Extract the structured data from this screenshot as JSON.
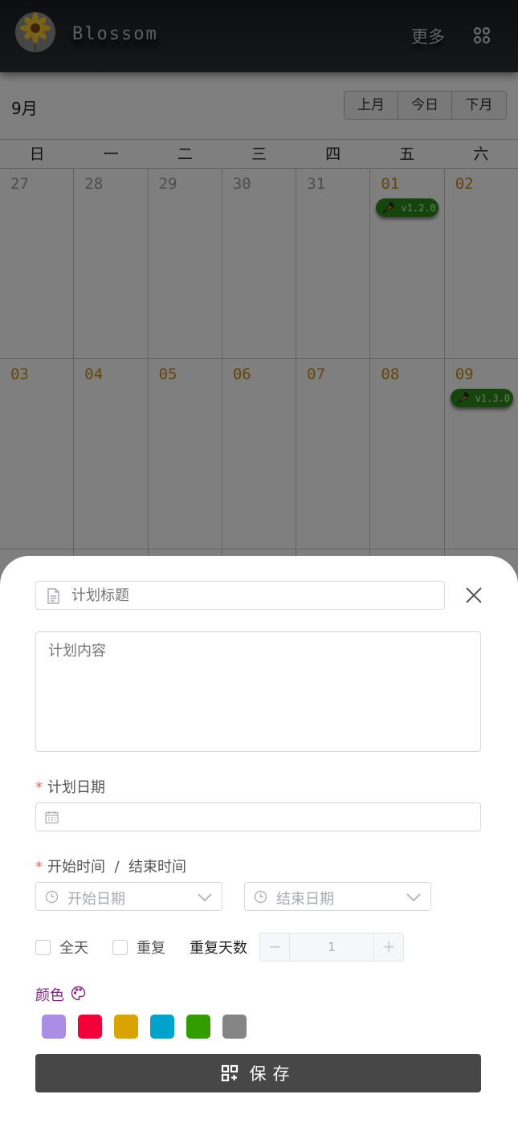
{
  "header": {
    "brand": "Blossom",
    "more_label": "更多"
  },
  "calendar": {
    "month_title": "9月",
    "nav": {
      "prev": "上月",
      "today": "今日",
      "next": "下月"
    },
    "weekdays": [
      "日",
      "一",
      "二",
      "三",
      "四",
      "五",
      "六"
    ],
    "rows": [
      [
        {
          "day": "27",
          "other": true
        },
        {
          "day": "28",
          "other": true
        },
        {
          "day": "29",
          "other": true
        },
        {
          "day": "30",
          "other": true
        },
        {
          "day": "31",
          "other": true
        },
        {
          "day": "01",
          "event": "v1.2.0"
        },
        {
          "day": "02"
        }
      ],
      [
        {
          "day": "03"
        },
        {
          "day": "04"
        },
        {
          "day": "05"
        },
        {
          "day": "06"
        },
        {
          "day": "07"
        },
        {
          "day": "08"
        },
        {
          "day": "09",
          "event": "v1.3.0"
        }
      ]
    ],
    "event_color": "#2b8a1a"
  },
  "form": {
    "title_placeholder": "计划标题",
    "content_placeholder": "计划内容",
    "date_label": "计划日期",
    "time_label": "开始时间  /  结束时间",
    "start_placeholder": "开始日期",
    "end_placeholder": "结束日期",
    "all_day_label": "全天",
    "repeat_label": "重复",
    "repeat_days_label": "重复天数",
    "repeat_days_value": "1",
    "minus": "−",
    "plus": "+",
    "color_label": "颜色",
    "colors": [
      "#ab8de6",
      "#f1003a",
      "#d9a300",
      "#00a3cc",
      "#339c00",
      "#858585"
    ],
    "save_label": "保存"
  }
}
